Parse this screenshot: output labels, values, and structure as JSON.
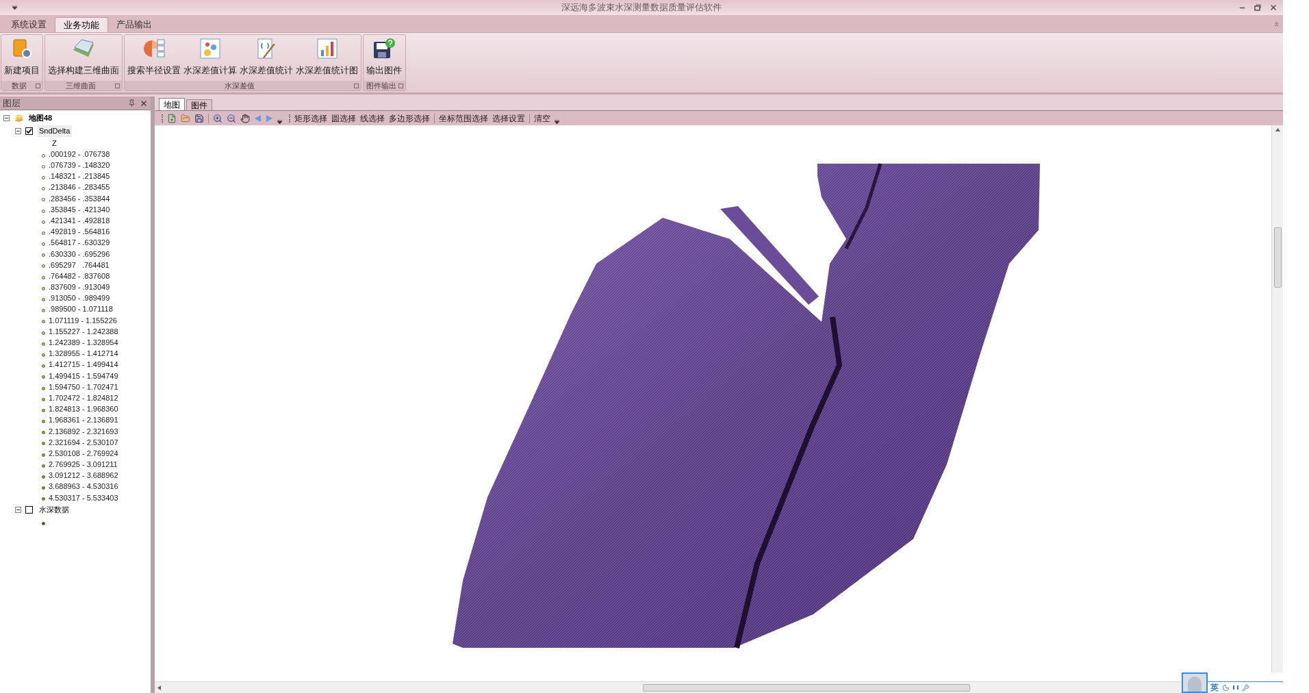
{
  "window": {
    "title": "深远海多波束水深测量数据质量评估软件"
  },
  "ribbon_tabs": [
    {
      "label": "系统设置",
      "selected": false
    },
    {
      "label": "业务功能",
      "selected": true
    },
    {
      "label": "产品输出",
      "selected": false
    }
  ],
  "ribbon_groups": [
    {
      "label": "数据",
      "buttons": [
        {
          "label": "新建项目",
          "kind": "project"
        }
      ]
    },
    {
      "label": "三维曲面",
      "buttons": [
        {
          "label": "选择构建三维曲面",
          "kind": "surface"
        }
      ]
    },
    {
      "label": "水深差值",
      "buttons": [
        {
          "label": "搜索半径设置",
          "kind": "radius"
        },
        {
          "label": "水深差值计算",
          "kind": "calc"
        },
        {
          "label": "水深差值统计",
          "kind": "stats"
        },
        {
          "label": "水深差值统计图",
          "kind": "chart"
        }
      ]
    },
    {
      "label": "图件输出",
      "buttons": [
        {
          "label": "输出图件",
          "kind": "export"
        }
      ]
    }
  ],
  "layer_panel": {
    "title": "图层",
    "tree": [
      {
        "label": "地图48",
        "expanded": true,
        "children": [
          {
            "label": "SndDelta",
            "checked": true,
            "expanded": true,
            "field": "Z",
            "legend": [
              {
                "label": ".000192 - .076738",
                "color": "#f4f4ec"
              },
              {
                "label": ".076739 - .148320",
                "color": "#f0f2e4"
              },
              {
                "label": ".148321 - .213845",
                "color": "#eceedc"
              },
              {
                "label": ".213846 - .283455",
                "color": "#e8ecd4"
              },
              {
                "label": ".283456 - .353844",
                "color": "#e4e8cc"
              },
              {
                "label": ".353845 - .421340",
                "color": "#e0e6c4"
              },
              {
                "label": ".421341 - .492818",
                "color": "#dce4bc"
              },
              {
                "label": ".492819 - .564816",
                "color": "#d8e0b4"
              },
              {
                "label": ".564817 - .630329",
                "color": "#d4deac"
              },
              {
                "label": ".630330 - .695296",
                "color": "#d0dca4"
              },
              {
                "label": ".695297   .764481",
                "color": "#ccd89c"
              },
              {
                "label": ".764482 - .837608",
                "color": "#c8d694"
              },
              {
                "label": ".837609 - .913049",
                "color": "#c4d48c"
              },
              {
                "label": ".913050 - .989499",
                "color": "#c0d084"
              },
              {
                "label": ".989500 - 1.071118",
                "color": "#bcce7c"
              },
              {
                "label": "1.071119 - 1.155226",
                "color": "#b8cc74"
              },
              {
                "label": "1.155227 - 1.242388",
                "color": "#b4c86c"
              },
              {
                "label": "1.242389 - 1.328954",
                "color": "#b0c664"
              },
              {
                "label": "1.328955 - 1.412714",
                "color": "#acc45c"
              },
              {
                "label": "1.412715 - 1.499414",
                "color": "#a8c054"
              },
              {
                "label": "1.499415 - 1.594749",
                "color": "#a4be4c"
              },
              {
                "label": "1.594750 - 1.702471",
                "color": "#a0bc44"
              },
              {
                "label": "1.702472 - 1.824812",
                "color": "#9cb83c"
              },
              {
                "label": "1.824813 - 1.968360",
                "color": "#98b438"
              },
              {
                "label": "1.968361 - 2.136891",
                "color": "#94b034"
              },
              {
                "label": "2.136892 - 2.321693",
                "color": "#90ac30"
              },
              {
                "label": "2.321694 - 2.530107",
                "color": "#8ca82c"
              },
              {
                "label": "2.530108 - 2.769924",
                "color": "#88a428"
              },
              {
                "label": "2.769925 - 3.091211",
                "color": "#84a024"
              },
              {
                "label": "3.091212 - 3.688962",
                "color": "#809c20"
              },
              {
                "label": "3.688963 - 4.530316",
                "color": "#7c981c"
              },
              {
                "label": "4.530317 - 5.533403",
                "color": "#789418"
              }
            ]
          },
          {
            "label": "水深数据",
            "checked": false,
            "expanded": true,
            "legend": [
              {
                "color": "#2e6a1a"
              }
            ]
          }
        ]
      }
    ]
  },
  "map_tabs": [
    {
      "label": "地图",
      "selected": true
    },
    {
      "label": "图件",
      "selected": false
    }
  ],
  "map_toolbar": {
    "select_groups": [
      [
        "矩形选择",
        "圆选择",
        "线选择",
        "多边形选择"
      ],
      [
        "坐标范围选择",
        "选择设置"
      ],
      [
        "清空"
      ]
    ]
  },
  "ime_bar": {
    "language": "英"
  }
}
